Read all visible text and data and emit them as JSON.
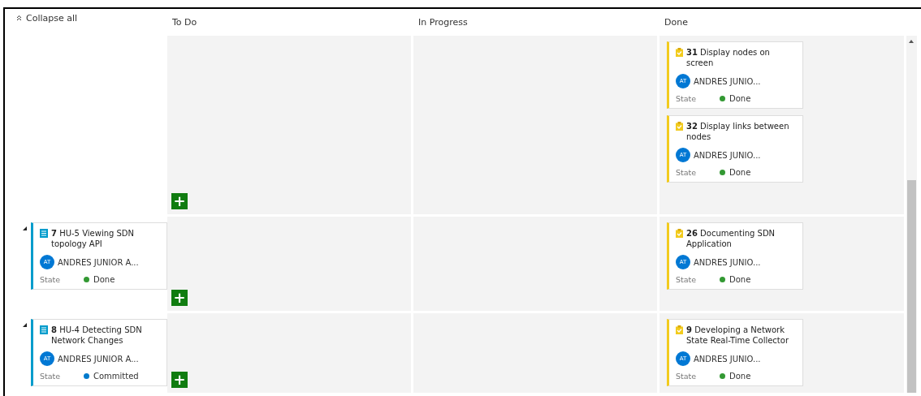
{
  "collapse_all": {
    "label": "Collapse all"
  },
  "columns": [
    {
      "title": "To Do"
    },
    {
      "title": "In Progress"
    },
    {
      "title": "Done"
    }
  ],
  "lanes": [
    {
      "add_button": {
        "label": "+"
      },
      "cells": [
        [],
        [],
        [
          {
            "kind": "task",
            "number": "31",
            "title": "Display nodes on screen",
            "initials": "AT",
            "assignee": "ANDRES JUNIO...",
            "field_label": "State",
            "state": "Done",
            "color": "#339933"
          },
          {
            "kind": "task",
            "number": "32",
            "title": "Display links between nodes",
            "initials": "AT",
            "assignee": "ANDRES JUNIO...",
            "field_label": "State",
            "state": "Done",
            "color": "#339933"
          }
        ]
      ]
    },
    {
      "parent": {
        "kind": "story",
        "expanded": true,
        "number": "7",
        "title": "HU-5 Viewing SDN topology API",
        "initials": "AT",
        "assignee": "ANDRES JUNIOR A...",
        "field_label": "State",
        "state": "Done",
        "color": "#339933"
      },
      "add_button": {
        "label": "+"
      },
      "cells": [
        [],
        [],
        [
          {
            "kind": "task",
            "number": "26",
            "title": "Documenting SDN Application",
            "initials": "AT",
            "assignee": "ANDRES JUNIO...",
            "field_label": "State",
            "state": "Done",
            "color": "#339933"
          }
        ]
      ]
    },
    {
      "parent": {
        "kind": "story",
        "expanded": true,
        "number": "8",
        "title": "HU-4 Detecting SDN Network Changes",
        "initials": "AT",
        "assignee": "ANDRES JUNIOR A...",
        "field_label": "State",
        "state": "Committed",
        "color": "#007acc"
      },
      "add_button": {
        "label": "+"
      },
      "cells": [
        [],
        [],
        [
          {
            "kind": "task",
            "number": "9",
            "title": "Developing a Network State Real-Time Collector",
            "initials": "AT",
            "assignee": "ANDRES JUNIO...",
            "field_label": "State",
            "state": "Done",
            "color": "#339933"
          }
        ]
      ]
    }
  ]
}
